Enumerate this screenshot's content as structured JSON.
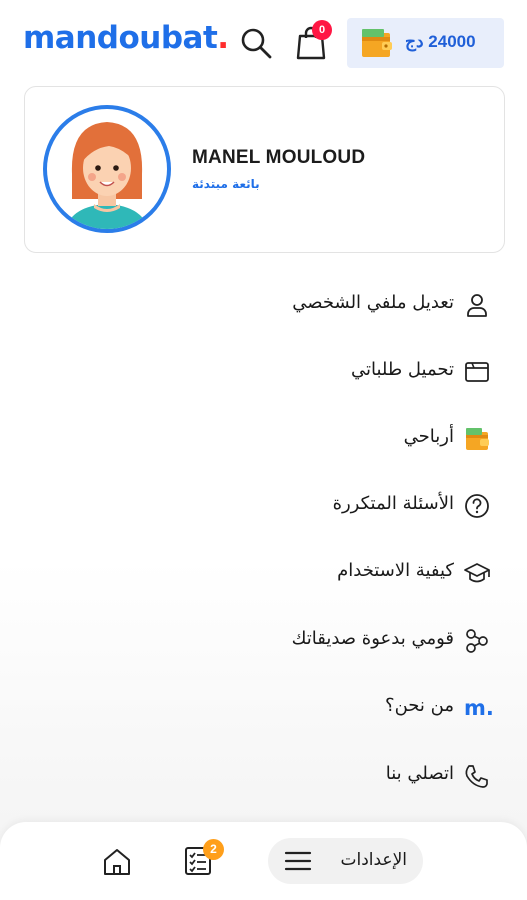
{
  "header": {
    "logo_text": "mandoubat",
    "logo_dot": ".",
    "cart_count": "0",
    "wallet_amount": "24000 دج"
  },
  "profile": {
    "name": "MANEL MOULOUD",
    "role": "بائعة مبتدئة"
  },
  "menu": {
    "items": [
      {
        "label": "تعديل ملفي الشخصي",
        "icon": "user-icon"
      },
      {
        "label": "تحميل طلباتي",
        "icon": "folder-icon"
      },
      {
        "label": "أرباحي",
        "icon": "wallet-icon"
      },
      {
        "label": "الأسئلة المتكررة",
        "icon": "question-icon"
      },
      {
        "label": "كيفية الاستخدام",
        "icon": "graduation-cap-icon"
      },
      {
        "label": "قومي بدعوة صديقاتك",
        "icon": "share-icon"
      },
      {
        "label": "من نحن؟",
        "icon": "brand-m-icon",
        "icon_text": "m."
      },
      {
        "label": "اتصلي بنا",
        "icon": "phone-icon"
      }
    ]
  },
  "bottom_nav": {
    "orders_count": "2",
    "settings_label": "الإعدادات"
  },
  "colors": {
    "brand_blue": "#1f6fe8",
    "brand_red": "#ff2d2d",
    "orders_badge": "#ff9f1a",
    "cart_badge": "#ff1744"
  }
}
